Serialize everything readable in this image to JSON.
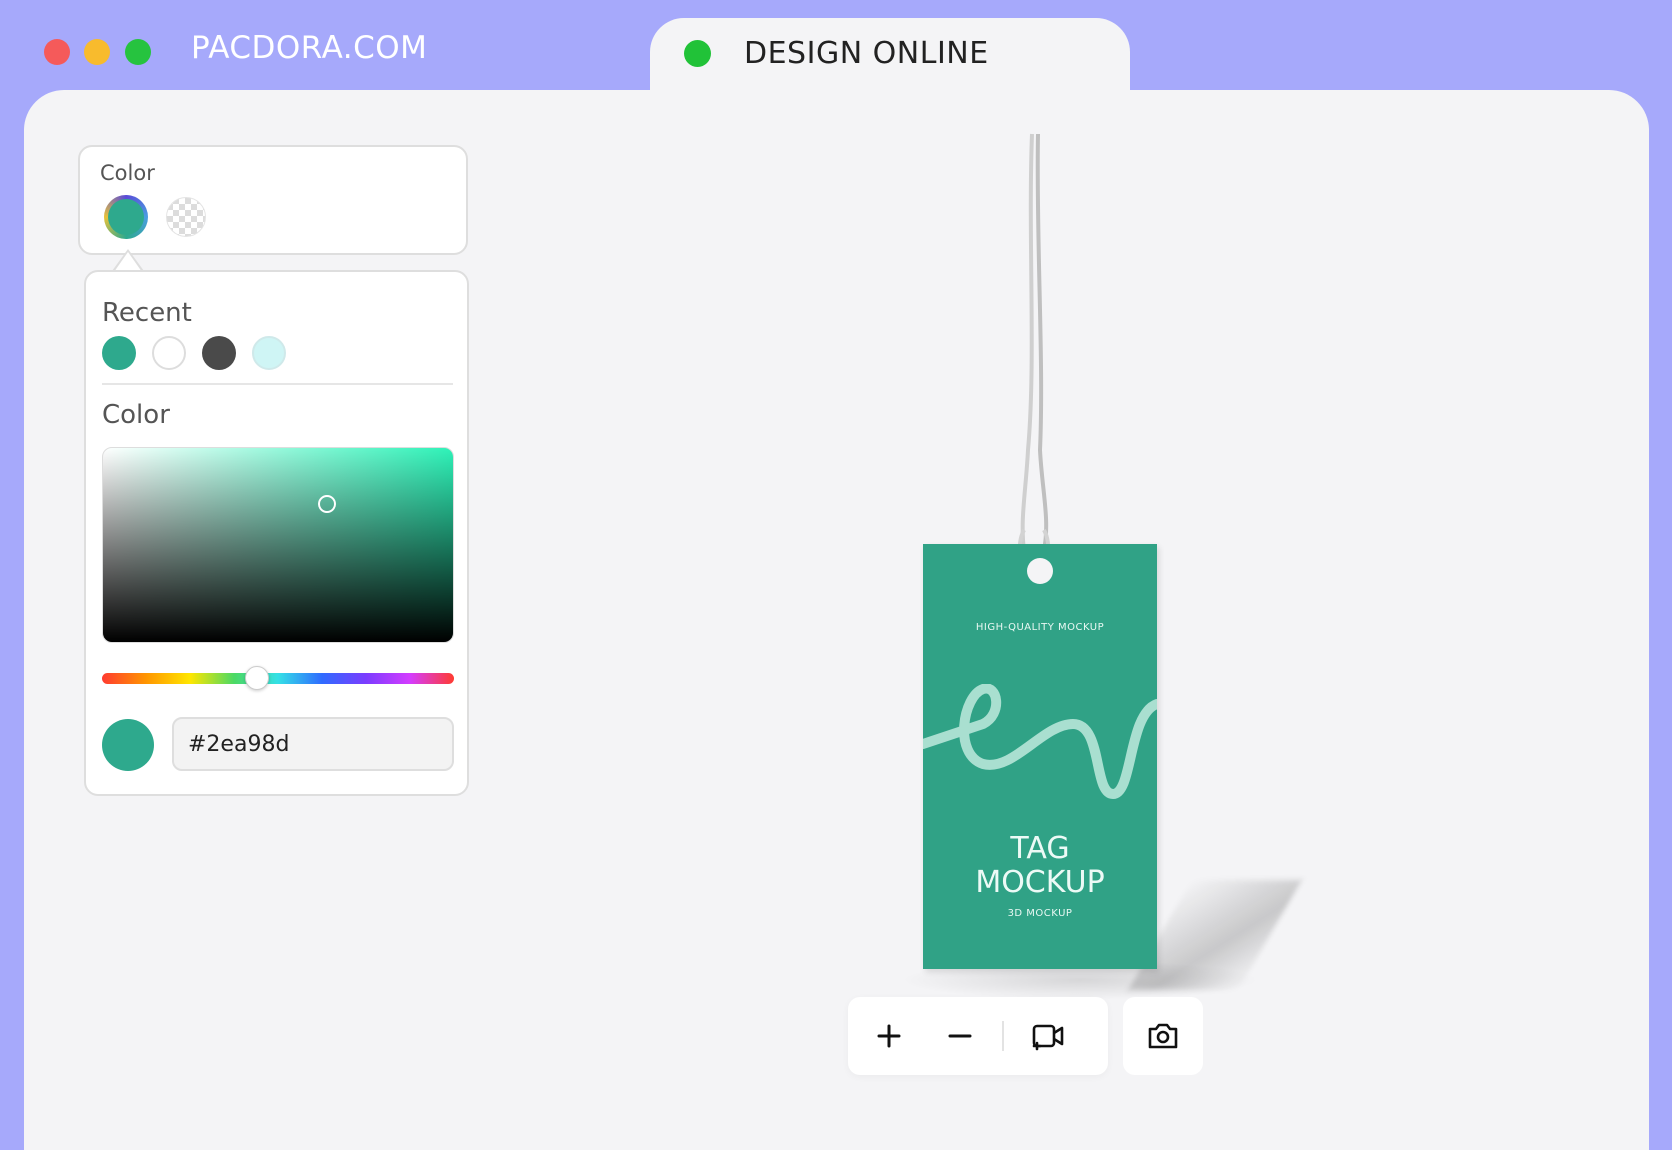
{
  "brand": "PACDORA.COM",
  "tab": {
    "label": "DESIGN ONLINE"
  },
  "colors": {
    "background": "#a6a9fb",
    "window": "#f4f4f6",
    "tab_dot": "#21c238",
    "accent": "#2ea98d"
  },
  "color_card": {
    "label": "Color",
    "swatches": [
      "selected-color",
      "transparent"
    ]
  },
  "picker": {
    "recent_title": "Recent",
    "recent_colors": [
      "#2ea98d",
      "#ffffff",
      "#4a4a4a",
      "#cff5f5"
    ],
    "color_title": "Color",
    "hue_position": 0.44,
    "current_color": "#2ea98d",
    "hex_value": "#2ea98d"
  },
  "tag": {
    "top_text": "HIGH-QUALITY MOCKUP",
    "title_line1": "TAG",
    "title_line2": "MOCKUP",
    "subtitle": "3D MOCKUP"
  },
  "toolbar": {
    "icons": [
      "plus-icon",
      "minus-icon",
      "video-camera-icon",
      "camera-icon"
    ]
  }
}
